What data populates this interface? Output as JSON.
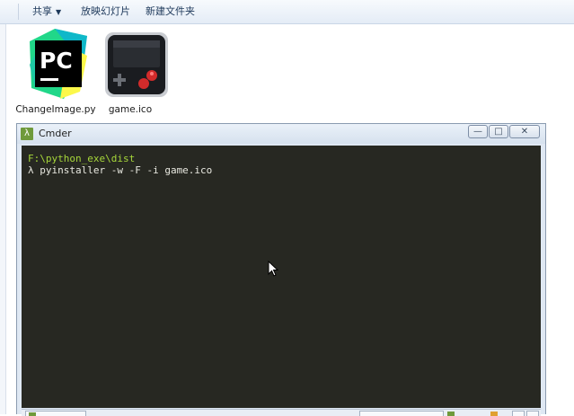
{
  "toolbar": {
    "share_label": "共享",
    "slideshow_label": "放映幻灯片",
    "new_folder_label": "新建文件夹"
  },
  "files": [
    {
      "name": "ChangeImage.py",
      "icon": "pycharm-icon"
    },
    {
      "name": "game.ico",
      "icon": "game-console-icon"
    }
  ],
  "cmder": {
    "title": "Cmder",
    "app_icon_glyph": "λ",
    "path": "F:\\python_exe\\dist",
    "command": "λ pyinstaller -w -F -i game.ico",
    "minimize_glyph": "—",
    "maximize_glyph": "□",
    "close_glyph": "✕"
  },
  "colors": {
    "console_bg": "#272822",
    "path_green": "#a6d63a",
    "cmder_green": "#6f9a3b",
    "pycharm_green": "#21d789",
    "pycharm_yellow": "#fcf84a"
  }
}
